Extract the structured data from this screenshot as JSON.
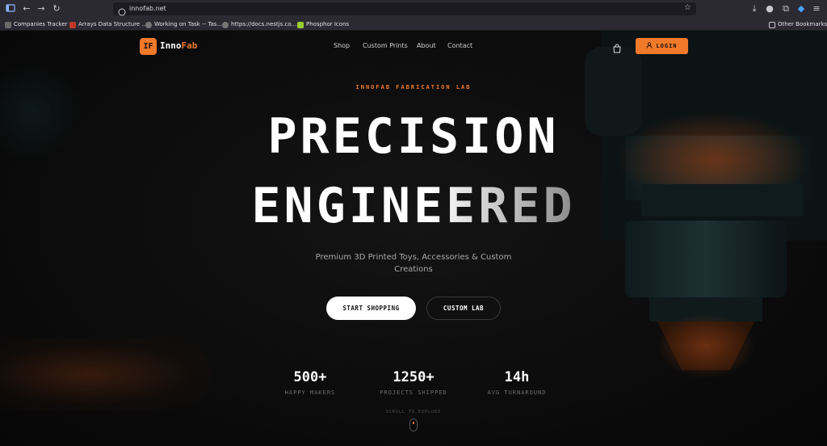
{
  "browser": {
    "url": "innofab.net",
    "bookmarks": [
      {
        "label": "Companies Tracker",
        "color": "#6b6b6b"
      },
      {
        "label": "Arrays Data Structure ...",
        "color": "#c0392b"
      },
      {
        "label": "Working on Task -- Tas...",
        "color": "#777777"
      },
      {
        "label": "https://docs.nestjs.co...",
        "color": "#777777"
      },
      {
        "label": "Phosphor Icons",
        "color": "#9acd32"
      }
    ],
    "other_bookmarks": "Other Bookmarks"
  },
  "brand": {
    "logo_mark": "IF",
    "name_part1": "Inno",
    "name_part2": "Fab",
    "accent_color": "#f07a2a"
  },
  "nav": {
    "links": [
      "Shop",
      "Custom Prints",
      "About",
      "Contact"
    ],
    "cart_icon": "shopping-bag-icon",
    "login_label": "LOGIN"
  },
  "hero": {
    "eyebrow": "INNOFAB FABRICATION LAB",
    "headline_line1": "PRECISION",
    "headline_line2": "ENGINEERED",
    "subtitle": "Premium 3D Printed Toys, Accessories & Custom Creations",
    "primary_cta": "START SHOPPING",
    "secondary_cta": "CUSTOM LAB"
  },
  "stats": [
    {
      "value": "500+",
      "label": "HAPPY MAKERS"
    },
    {
      "value": "1250+",
      "label": "PROJECTS SHIPPED"
    },
    {
      "value": "14h",
      "label": "AVG TURNAROUND"
    }
  ],
  "scroll_hint": "SCROLL TO EXPLORE"
}
